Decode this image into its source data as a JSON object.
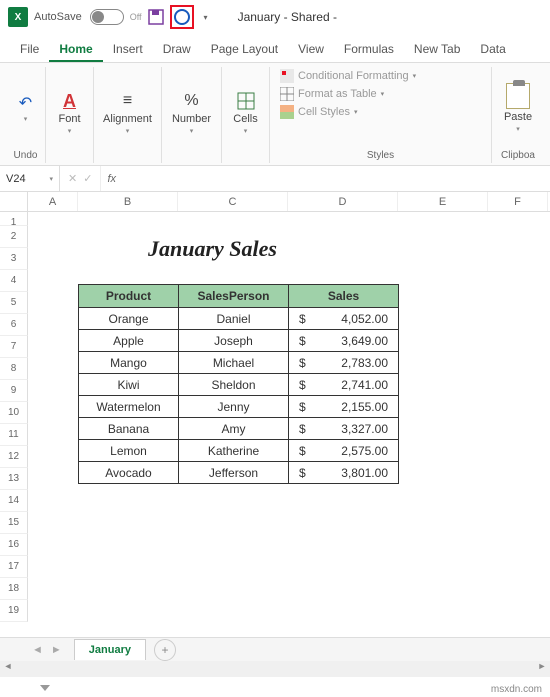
{
  "titlebar": {
    "autosave_label": "AutoSave",
    "autosave_state": "Off",
    "doc_title": "January - Shared -"
  },
  "menu": {
    "file": "File",
    "home": "Home",
    "insert": "Insert",
    "draw": "Draw",
    "page_layout": "Page Layout",
    "view": "View",
    "formulas": "Formulas",
    "new_tab": "New Tab",
    "data": "Data"
  },
  "ribbon": {
    "undo": "Undo",
    "font": "Font",
    "alignment": "Alignment",
    "number": "Number",
    "cells": "Cells",
    "styles_group": "Styles",
    "cond_fmt": "Conditional Formatting",
    "fmt_table": "Format as Table",
    "cell_styles": "Cell Styles",
    "paste": "Paste",
    "clipboard": "Clipboa"
  },
  "formula_bar": {
    "cell_ref": "V24",
    "fx": "fx"
  },
  "columns": {
    "A": "A",
    "B": "B",
    "C": "C",
    "D": "D",
    "E": "E",
    "F": "F"
  },
  "sheet": {
    "title": "January Sales",
    "headers": {
      "product": "Product",
      "salesperson": "SalesPerson",
      "sales": "Sales"
    },
    "currency": "$",
    "rows": [
      {
        "product": "Orange",
        "person": "Daniel",
        "sales": "4,052.00"
      },
      {
        "product": "Apple",
        "person": "Joseph",
        "sales": "3,649.00"
      },
      {
        "product": "Mango",
        "person": "Michael",
        "sales": "2,783.00"
      },
      {
        "product": "Kiwi",
        "person": "Sheldon",
        "sales": "2,741.00"
      },
      {
        "product": "Watermelon",
        "person": "Jenny",
        "sales": "2,155.00"
      },
      {
        "product": "Banana",
        "person": "Amy",
        "sales": "3,327.00"
      },
      {
        "product": "Lemon",
        "person": "Katherine",
        "sales": "2,575.00"
      },
      {
        "product": "Avocado",
        "person": "Jefferson",
        "sales": "3,801.00"
      }
    ]
  },
  "tabs": {
    "sheet1": "January"
  },
  "watermark": "msxdn.com"
}
